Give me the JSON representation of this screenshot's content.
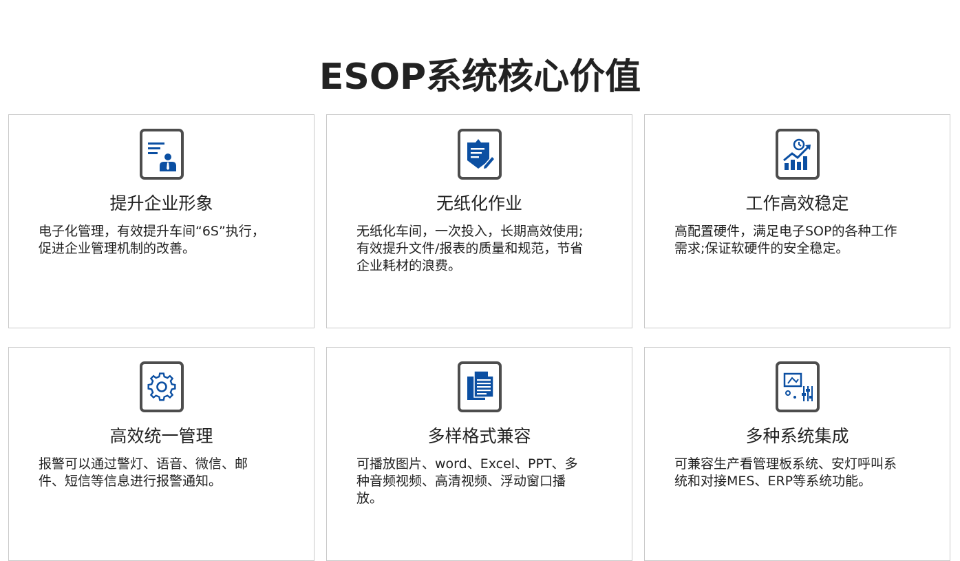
{
  "page": {
    "title": "ESOP系统核心价值"
  },
  "colors": {
    "accent": "#0b4fa2",
    "icon_frame": "#4d4d4d",
    "card_border": "#c9c9c9",
    "text": "#222222"
  },
  "cards": [
    {
      "icon": "business-profile-icon",
      "title": "提升企业形象",
      "desc": "电子化管理，有效提升车间“6S”执行，促进企业管理机制的改善。"
    },
    {
      "icon": "paperless-document-icon",
      "title": "无纸化作业",
      "desc": "无纸化车间，一次投入，长期高效使用;有效提升文件/报表的质量和规范，节省企业耗材的浪费。"
    },
    {
      "icon": "efficiency-chart-icon",
      "title": "工作高效稳定",
      "desc": "高配置硬件，满足电子SOP的各种工作需求;保证软硬件的安全稳定。"
    },
    {
      "icon": "gear-icon",
      "title": "高效统一管理",
      "desc": "报警可以通过警灯、语音、微信、邮件、短信等信息进行报警通知。"
    },
    {
      "icon": "multi-document-icon",
      "title": "多样格式兼容",
      "desc": "可播放图片、word、Excel、PPT、多种音频视频、高清视频、浮动窗口播放。"
    },
    {
      "icon": "control-panel-icon",
      "title": "多种系统集成",
      "desc": "可兼容生产看管理板系统、安灯呼叫系统和对接MES、ERP等系统功能。"
    }
  ]
}
